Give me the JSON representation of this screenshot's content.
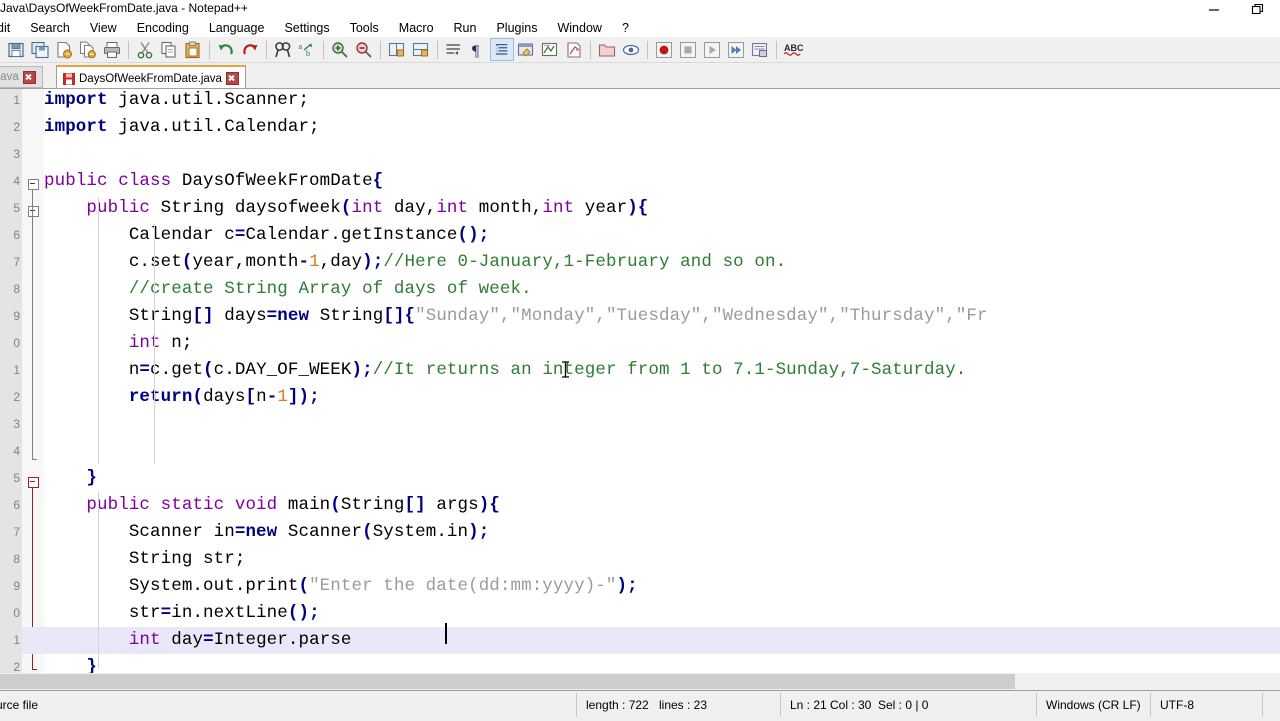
{
  "window": {
    "title": "Java\\DaysOfWeekFromDate.java - Notepad++",
    "controls": {
      "minimize": "minimize-button",
      "restore": "restore-button"
    }
  },
  "menu": {
    "items": [
      {
        "label": "dit",
        "name": "menu-edit"
      },
      {
        "label": "Search",
        "name": "menu-search"
      },
      {
        "label": "View",
        "name": "menu-view"
      },
      {
        "label": "Encoding",
        "name": "menu-encoding"
      },
      {
        "label": "Language",
        "name": "menu-language"
      },
      {
        "label": "Settings",
        "name": "menu-settings"
      },
      {
        "label": "Tools",
        "name": "menu-tools"
      },
      {
        "label": "Macro",
        "name": "menu-macro"
      },
      {
        "label": "Run",
        "name": "menu-run"
      },
      {
        "label": "Plugins",
        "name": "menu-plugins"
      },
      {
        "label": "Window",
        "name": "menu-window"
      },
      {
        "label": "?",
        "name": "menu-help"
      }
    ]
  },
  "toolbar": {
    "buttons": [
      "save-icon",
      "save-all-icon",
      "close-icon",
      "close-all-icon",
      "print-icon",
      "cut-icon",
      "copy-icon",
      "paste-icon",
      "undo-icon",
      "redo-icon",
      "find-icon",
      "replace-icon",
      "zoom-in-icon",
      "zoom-out-icon",
      "sync-vertical-icon",
      "sync-horizontal-icon",
      "word-wrap-icon",
      "show-all-characters-icon",
      "indent-guide-icon",
      "user-defined-dialog-icon",
      "show-document-map-icon",
      "function-list-icon",
      "folder-as-workspace-icon",
      "monitoring-icon",
      "record-macro-icon",
      "stop-recording-icon",
      "play-macro-icon",
      "run-macro-multiple-icon",
      "save-macro-icon",
      "spell-check-icon"
    ]
  },
  "tabs": [
    {
      "label": "ck.java",
      "active": false,
      "name": "tab-inactive"
    },
    {
      "label": "DaysOfWeekFromDate.java",
      "active": true,
      "name": "tab-daysofweekfromdate"
    }
  ],
  "editor": {
    "line_numbers": [
      "1",
      "2",
      "3",
      "4",
      "5",
      "6",
      "7",
      "8",
      "9",
      "0",
      "1",
      "2",
      "3",
      "4",
      "5",
      "6",
      "7",
      "8",
      "9",
      "0",
      "1",
      "2"
    ],
    "current_line": 21,
    "lines": [
      {
        "n": 1,
        "tokens": [
          {
            "t": "import",
            "c": "kwb"
          },
          {
            "t": " java.util.Scanner;",
            "c": ""
          }
        ]
      },
      {
        "n": 2,
        "tokens": [
          {
            "t": "import",
            "c": "kwb"
          },
          {
            "t": " java.util.Calendar;",
            "c": ""
          }
        ]
      },
      {
        "n": 3,
        "tokens": []
      },
      {
        "n": 4,
        "tokens": [
          {
            "t": "public class",
            "c": "kw"
          },
          {
            "t": " DaysOfWeekFromDate",
            "c": ""
          },
          {
            "t": "{",
            "c": "op"
          }
        ]
      },
      {
        "n": 5,
        "tokens": [
          {
            "t": "    ",
            "c": ""
          },
          {
            "t": "public",
            "c": "kw"
          },
          {
            "t": " String daysofweek",
            "c": ""
          },
          {
            "t": "(",
            "c": "op"
          },
          {
            "t": "int",
            "c": "kw"
          },
          {
            "t": " day,",
            "c": ""
          },
          {
            "t": "int",
            "c": "kw"
          },
          {
            "t": " month,",
            "c": ""
          },
          {
            "t": "int",
            "c": "kw"
          },
          {
            "t": " year",
            "c": ""
          },
          {
            "t": "){",
            "c": "op"
          }
        ]
      },
      {
        "n": 6,
        "tokens": [
          {
            "t": "        Calendar c",
            "c": ""
          },
          {
            "t": "=",
            "c": "op"
          },
          {
            "t": "Calendar.getInstance",
            "c": ""
          },
          {
            "t": "();",
            "c": "op"
          }
        ]
      },
      {
        "n": 7,
        "tokens": [
          {
            "t": "        c.set",
            "c": ""
          },
          {
            "t": "(",
            "c": "op"
          },
          {
            "t": "year,month",
            "c": ""
          },
          {
            "t": "-",
            "c": "op"
          },
          {
            "t": "1",
            "c": "num"
          },
          {
            "t": ",day",
            "c": ""
          },
          {
            "t": ");",
            "c": "op"
          },
          {
            "t": "//Here 0-January,1-February and so on.",
            "c": "cmt"
          }
        ]
      },
      {
        "n": 8,
        "tokens": [
          {
            "t": "        ",
            "c": ""
          },
          {
            "t": "//create String Array of days of week.",
            "c": "cmt"
          }
        ]
      },
      {
        "n": 9,
        "tokens": [
          {
            "t": "        String",
            "c": ""
          },
          {
            "t": "[]",
            "c": "op"
          },
          {
            "t": " days",
            "c": ""
          },
          {
            "t": "=",
            "c": "op"
          },
          {
            "t": "new",
            "c": "kwb"
          },
          {
            "t": " String",
            "c": ""
          },
          {
            "t": "[]{",
            "c": "op"
          },
          {
            "t": "\"Sunday\",\"Monday\",\"Tuesday\",\"Wednesday\",\"Thursday\",\"Fr",
            "c": "str"
          }
        ]
      },
      {
        "n": 10,
        "tokens": [
          {
            "t": "        ",
            "c": ""
          },
          {
            "t": "int",
            "c": "kw"
          },
          {
            "t": " n;",
            "c": ""
          }
        ]
      },
      {
        "n": 11,
        "tokens": [
          {
            "t": "        n",
            "c": ""
          },
          {
            "t": "=",
            "c": "op"
          },
          {
            "t": "c.get",
            "c": ""
          },
          {
            "t": "(",
            "c": "op"
          },
          {
            "t": "c.DAY_OF_WEEK",
            "c": ""
          },
          {
            "t": ");",
            "c": "op"
          },
          {
            "t": "//It returns an integer from 1 to 7.1-Sunday,7-Saturday.",
            "c": "cmt"
          }
        ]
      },
      {
        "n": 12,
        "tokens": [
          {
            "t": "        ",
            "c": ""
          },
          {
            "t": "return",
            "c": "kwb"
          },
          {
            "t": "(",
            "c": "op"
          },
          {
            "t": "days",
            "c": ""
          },
          {
            "t": "[",
            "c": "op"
          },
          {
            "t": "n",
            "c": ""
          },
          {
            "t": "-",
            "c": "op"
          },
          {
            "t": "1",
            "c": "num"
          },
          {
            "t": "]);",
            "c": "op"
          }
        ]
      },
      {
        "n": 13,
        "tokens": []
      },
      {
        "n": 14,
        "tokens": []
      },
      {
        "n": 15,
        "tokens": [
          {
            "t": "    ",
            "c": ""
          },
          {
            "t": "}",
            "c": "op"
          }
        ]
      },
      {
        "n": 16,
        "tokens": [
          {
            "t": "    ",
            "c": ""
          },
          {
            "t": "public static void",
            "c": "kw"
          },
          {
            "t": " main",
            "c": ""
          },
          {
            "t": "(",
            "c": "op"
          },
          {
            "t": "String",
            "c": ""
          },
          {
            "t": "[]",
            "c": "op"
          },
          {
            "t": " args",
            "c": ""
          },
          {
            "t": "){",
            "c": "op"
          }
        ]
      },
      {
        "n": 17,
        "tokens": [
          {
            "t": "        Scanner in",
            "c": ""
          },
          {
            "t": "=",
            "c": "op"
          },
          {
            "t": "new",
            "c": "kwb"
          },
          {
            "t": " Scanner",
            "c": ""
          },
          {
            "t": "(",
            "c": "op"
          },
          {
            "t": "System.in",
            "c": ""
          },
          {
            "t": ");",
            "c": "op"
          }
        ]
      },
      {
        "n": 18,
        "tokens": [
          {
            "t": "        String str;",
            "c": ""
          }
        ]
      },
      {
        "n": 19,
        "tokens": [
          {
            "t": "        System.out.print",
            "c": ""
          },
          {
            "t": "(",
            "c": "op"
          },
          {
            "t": "\"Enter the date(dd:mm:yyyy)-\"",
            "c": "str"
          },
          {
            "t": ");",
            "c": "op"
          }
        ]
      },
      {
        "n": 20,
        "tokens": [
          {
            "t": "        str",
            "c": ""
          },
          {
            "t": "=",
            "c": "op"
          },
          {
            "t": "in.nextLine",
            "c": ""
          },
          {
            "t": "();",
            "c": "op"
          }
        ]
      },
      {
        "n": 21,
        "tokens": [
          {
            "t": "        ",
            "c": ""
          },
          {
            "t": "int",
            "c": "kw"
          },
          {
            "t": " day",
            "c": ""
          },
          {
            "t": "=",
            "c": "op"
          },
          {
            "t": "Integer.parse",
            "c": ""
          }
        ]
      },
      {
        "n": 22,
        "tokens": [
          {
            "t": "    ",
            "c": ""
          },
          {
            "t": "}",
            "c": "op"
          }
        ]
      }
    ],
    "colors": {
      "keyword": "#8000a0",
      "keyword_bold": "#000080",
      "operator": "#000080",
      "number": "#d08020",
      "comment": "#2e7d32",
      "string": "#9b9b9b",
      "current_line_bg": "#e8e8f8",
      "gutter_bg": "#e4e4e4"
    }
  },
  "statusbar": {
    "doc_type": "urce file",
    "length": "length : 722",
    "lines": "lines : 23",
    "ln": "Ln : 21",
    "col": "Col : 30",
    "sel": "Sel : 0 | 0",
    "eol": "Windows (CR LF)",
    "encoding": "UTF-8"
  }
}
